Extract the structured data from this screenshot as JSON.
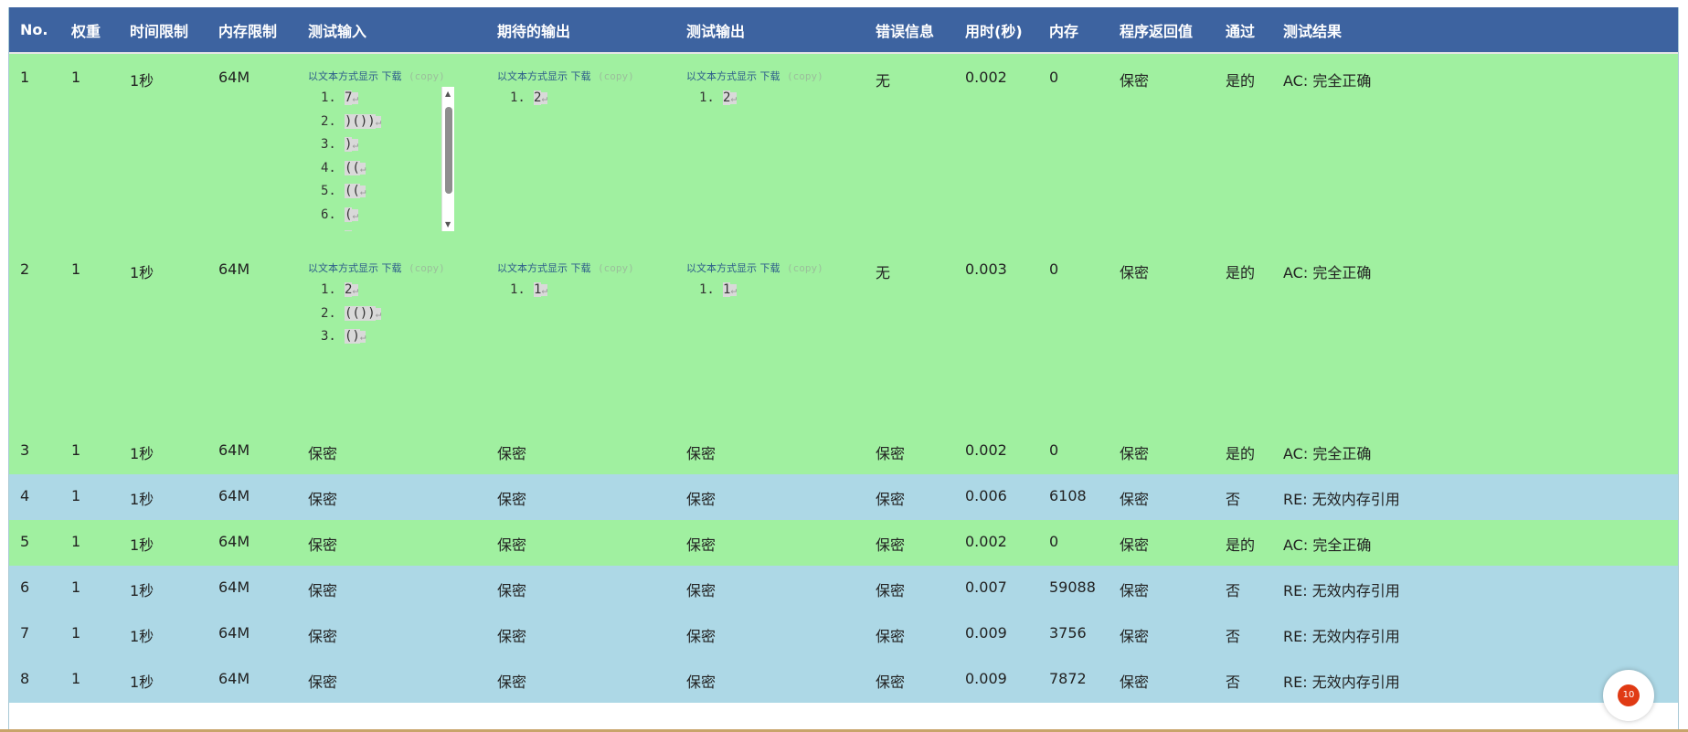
{
  "headers": [
    "No.",
    "权重",
    "时间限制",
    "内存限制",
    "测试输入",
    "期待的输出",
    "测试输出",
    "错误信息",
    "用时(秒)",
    "内存",
    "程序返回值",
    "通过",
    "测试结果"
  ],
  "links": {
    "text_view": "以文本方式显示",
    "download": "下载",
    "copy": "(copy)"
  },
  "rows": [
    {
      "status": "pass",
      "no": "1",
      "weight": "1",
      "time_limit": "1秒",
      "mem_limit": "64M",
      "input_lines": [
        "7",
        ")())",
        ")",
        "((",
        "((",
        "(",
        ")"
      ],
      "expected_lines": [
        "2"
      ],
      "output_lines": [
        "2"
      ],
      "error": "无",
      "time": "0.002",
      "memory": "0",
      "return_value": "保密",
      "passed": "是的",
      "result": "AC: 完全正确"
    },
    {
      "status": "pass",
      "no": "2",
      "weight": "1",
      "time_limit": "1秒",
      "mem_limit": "64M",
      "input_lines": [
        "2",
        "(())",
        "()"
      ],
      "expected_lines": [
        "1"
      ],
      "output_lines": [
        "1"
      ],
      "error": "无",
      "time": "0.003",
      "memory": "0",
      "return_value": "保密",
      "passed": "是的",
      "result": "AC: 完全正确"
    },
    {
      "status": "pass",
      "no": "3",
      "weight": "1",
      "time_limit": "1秒",
      "mem_limit": "64M",
      "input": "保密",
      "expected": "保密",
      "output": "保密",
      "error": "保密",
      "time": "0.002",
      "memory": "0",
      "return_value": "保密",
      "passed": "是的",
      "result": "AC: 完全正确"
    },
    {
      "status": "fail",
      "no": "4",
      "weight": "1",
      "time_limit": "1秒",
      "mem_limit": "64M",
      "input": "保密",
      "expected": "保密",
      "output": "保密",
      "error": "保密",
      "time": "0.006",
      "memory": "6108",
      "return_value": "保密",
      "passed": "否",
      "result": "RE: 无效内存引用"
    },
    {
      "status": "pass",
      "no": "5",
      "weight": "1",
      "time_limit": "1秒",
      "mem_limit": "64M",
      "input": "保密",
      "expected": "保密",
      "output": "保密",
      "error": "保密",
      "time": "0.002",
      "memory": "0",
      "return_value": "保密",
      "passed": "是的",
      "result": "AC: 完全正确"
    },
    {
      "status": "fail",
      "no": "6",
      "weight": "1",
      "time_limit": "1秒",
      "mem_limit": "64M",
      "input": "保密",
      "expected": "保密",
      "output": "保密",
      "error": "保密",
      "time": "0.007",
      "memory": "59088",
      "return_value": "保密",
      "passed": "否",
      "result": "RE: 无效内存引用"
    },
    {
      "status": "fail",
      "no": "7",
      "weight": "1",
      "time_limit": "1秒",
      "mem_limit": "64M",
      "input": "保密",
      "expected": "保密",
      "output": "保密",
      "error": "保密",
      "time": "0.009",
      "memory": "3756",
      "return_value": "保密",
      "passed": "否",
      "result": "RE: 无效内存引用"
    },
    {
      "status": "fail",
      "no": "8",
      "weight": "1",
      "time_limit": "1秒",
      "mem_limit": "64M",
      "input": "保密",
      "expected": "保密",
      "output": "保密",
      "error": "保密",
      "time": "0.009",
      "memory": "7872",
      "return_value": "保密",
      "passed": "否",
      "result": "RE: 无效内存引用"
    }
  ],
  "notification_badge": {
    "count": "10"
  },
  "colors": {
    "header": "#3d63a0",
    "pass_row": "#a0f0a0",
    "fail_row": "#add8e6",
    "badge": "#e03a14"
  }
}
